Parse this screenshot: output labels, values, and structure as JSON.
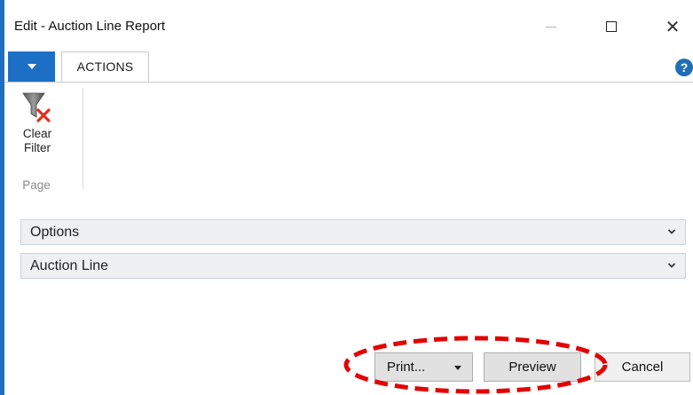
{
  "window": {
    "title": "Edit - Auction Line Report",
    "minimize_icon": "minimize-icon",
    "maximize_icon": "maximize-icon",
    "close_glyph": "✕"
  },
  "ribbon": {
    "tabs": [
      {
        "label": "ACTIONS"
      }
    ],
    "help_glyph": "?",
    "groups": [
      {
        "label": "Page",
        "items": [
          {
            "label_line1": "Clear",
            "label_line2": "Filter",
            "icon": "clear-filter-icon"
          }
        ]
      }
    ]
  },
  "fasttabs": [
    {
      "label": "Options"
    },
    {
      "label": "Auction Line"
    }
  ],
  "buttons": {
    "print": "Print...",
    "preview": "Preview",
    "cancel": "Cancel"
  },
  "colors": {
    "accent": "#1d6fc6",
    "highlight": "#e30000"
  }
}
